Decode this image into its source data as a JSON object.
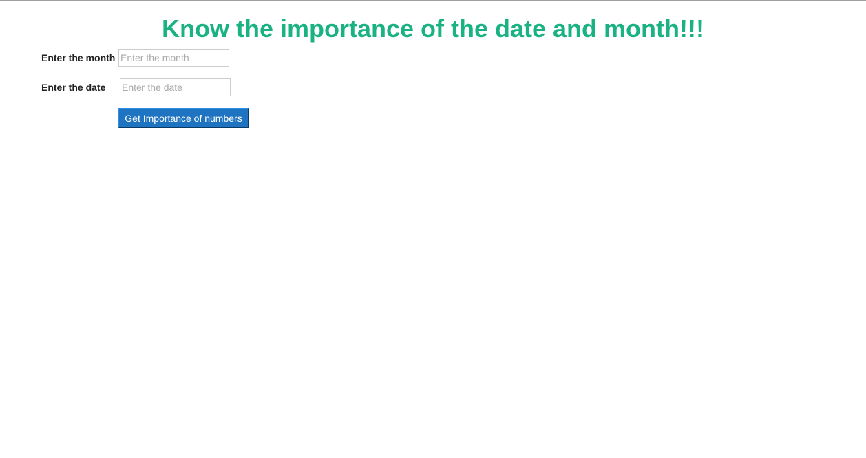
{
  "page": {
    "title": "Know the importance of the date and month!!!"
  },
  "form": {
    "month_label": "Enter the month",
    "month_placeholder": "Enter the month",
    "month_value": "",
    "date_label": "Enter the date",
    "date_placeholder": "Enter the date",
    "date_value": "",
    "submit_label": "Get Importance of numbers"
  },
  "colors": {
    "title": "#1bb283",
    "button": "#1f74c1"
  }
}
